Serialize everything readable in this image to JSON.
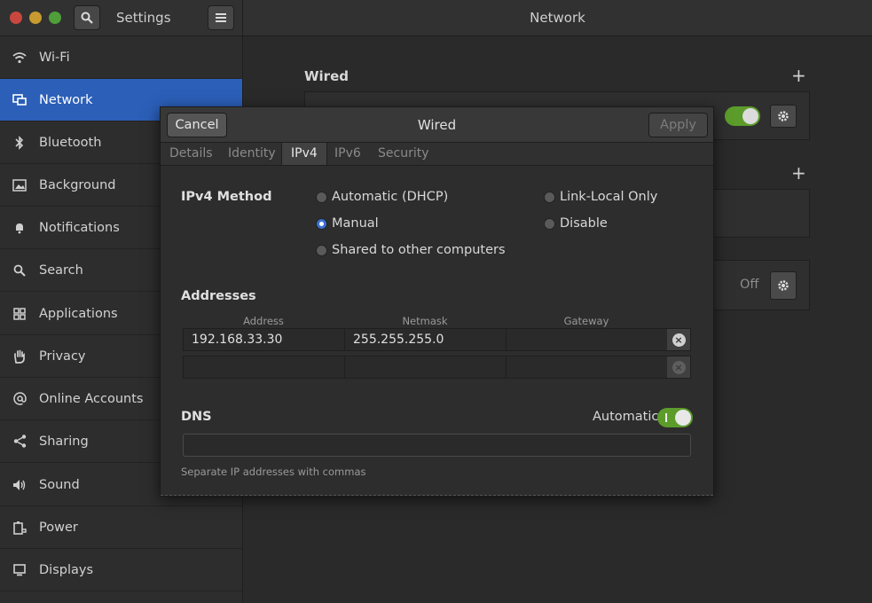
{
  "titlebar": {
    "settings_title": "Settings",
    "page_title": "Network"
  },
  "sidebar": {
    "items": [
      {
        "label": "Wi-Fi",
        "icon": "wifi-icon"
      },
      {
        "label": "Network",
        "icon": "network-icon",
        "active": true
      },
      {
        "label": "Bluetooth",
        "icon": "bluetooth-icon"
      },
      {
        "label": "Background",
        "icon": "background-icon"
      },
      {
        "label": "Notifications",
        "icon": "bell-icon"
      },
      {
        "label": "Search",
        "icon": "search-icon"
      },
      {
        "label": "Applications",
        "icon": "applications-icon"
      },
      {
        "label": "Privacy",
        "icon": "hand-icon"
      },
      {
        "label": "Online Accounts",
        "icon": "at-icon"
      },
      {
        "label": "Sharing",
        "icon": "share-icon"
      },
      {
        "label": "Sound",
        "icon": "speaker-icon"
      },
      {
        "label": "Power",
        "icon": "power-icon"
      },
      {
        "label": "Displays",
        "icon": "display-icon"
      }
    ]
  },
  "main": {
    "wired_title": "Wired",
    "vpn_status": "Off"
  },
  "dialog": {
    "title": "Wired",
    "cancel_label": "Cancel",
    "apply_label": "Apply",
    "tabs": [
      "Details",
      "Identity",
      "IPv4",
      "IPv6",
      "Security"
    ],
    "active_tab": "IPv4",
    "ipv4_method_label": "IPv4 Method",
    "methods": {
      "automatic": "Automatic (DHCP)",
      "link_local": "Link-Local Only",
      "manual": "Manual",
      "disable": "Disable",
      "shared": "Shared to other computers"
    },
    "selected_method": "Manual",
    "addresses_label": "Addresses",
    "columns": {
      "address": "Address",
      "netmask": "Netmask",
      "gateway": "Gateway"
    },
    "rows": [
      {
        "address": "192.168.33.30",
        "netmask": "255.255.255.0",
        "gateway": ""
      },
      {
        "address": "",
        "netmask": "",
        "gateway": ""
      }
    ],
    "dns_label": "DNS",
    "automatic_label": "Automatic",
    "dns_automatic": true,
    "dns_value": "",
    "dns_hint": "Separate IP addresses with commas"
  },
  "colors": {
    "accent": "#2b5fb8",
    "toggle_on": "#5c9c2b",
    "radio_selected": "#3a6fd0"
  }
}
